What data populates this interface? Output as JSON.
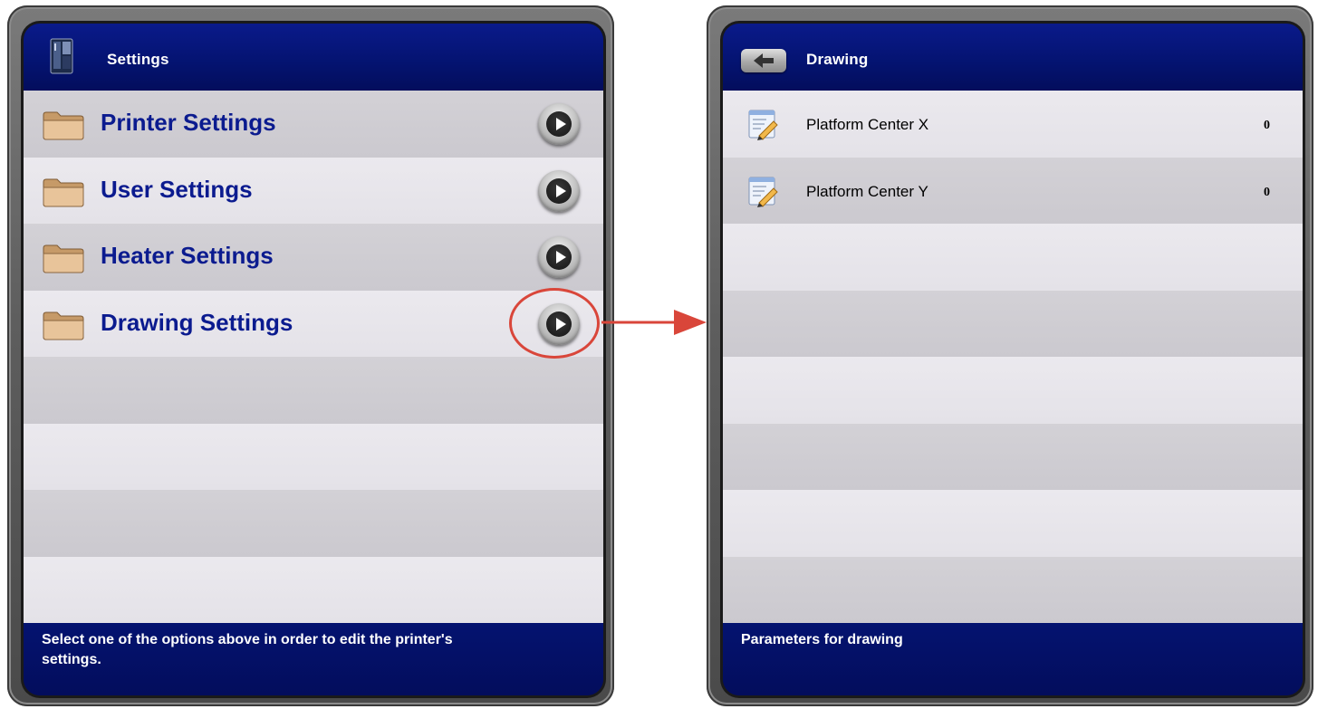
{
  "left_panel": {
    "header": {
      "title": "Settings",
      "icon": "printer-device-icon"
    },
    "items": [
      {
        "label": "Printer Settings",
        "icon": "folder-icon",
        "action_icon": "play-arrow-icon"
      },
      {
        "label": "User Settings",
        "icon": "folder-icon",
        "action_icon": "play-arrow-icon"
      },
      {
        "label": "Heater Settings",
        "icon": "folder-icon",
        "action_icon": "play-arrow-icon"
      },
      {
        "label": "Drawing Settings",
        "icon": "folder-icon",
        "action_icon": "play-arrow-icon"
      }
    ],
    "footer": {
      "text": "Select one of the options above in order to edit the printer's settings."
    }
  },
  "right_panel": {
    "header": {
      "title": "Drawing",
      "back_icon": "back-arrow-icon"
    },
    "items": [
      {
        "label": "Platform Center X",
        "value": "0",
        "icon": "edit-document-icon"
      },
      {
        "label": "Platform Center Y",
        "value": "0",
        "icon": "edit-document-icon"
      }
    ],
    "footer": {
      "text": "Parameters for drawing"
    }
  },
  "annotation": {
    "color": "#d9463a",
    "target": "Drawing Settings"
  },
  "colors": {
    "header_blue": "#041370",
    "label_blue": "#0b1b8f",
    "row_dark": "#cfcdd3",
    "row_light": "#e8e6eb"
  }
}
